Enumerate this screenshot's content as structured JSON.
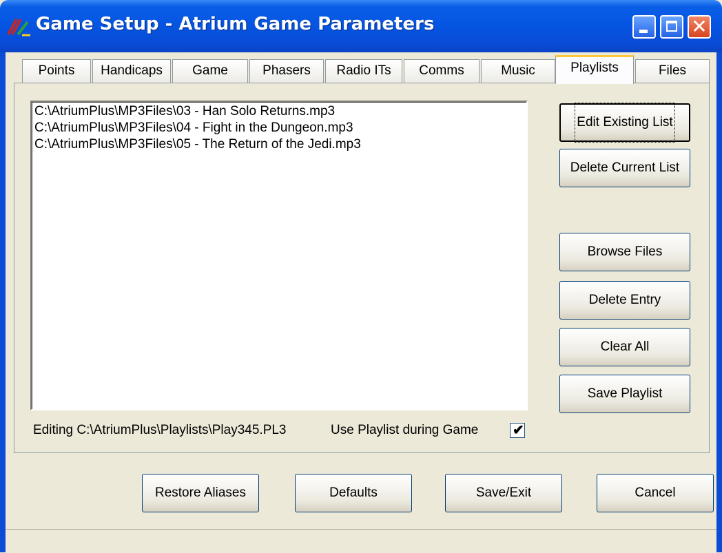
{
  "window": {
    "title": "Game Setup - Atrium Game Parameters",
    "close_glyph": "✕",
    "icons": [
      "app-icon",
      "minimize-icon",
      "maximize-icon",
      "close-icon"
    ]
  },
  "tabs": [
    {
      "label": "Points"
    },
    {
      "label": "Handicaps"
    },
    {
      "label": "Game"
    },
    {
      "label": "Phasers"
    },
    {
      "label": "Radio ITs"
    },
    {
      "label": "Comms"
    },
    {
      "label": "Music"
    },
    {
      "label": "Playlists",
      "active": true
    },
    {
      "label": "Files"
    }
  ],
  "playlist": {
    "entries": [
      "C:\\AtriumPlus\\MP3Files\\03 - Han Solo Returns.mp3",
      "C:\\AtriumPlus\\MP3Files\\04 - Fight in the Dungeon.mp3",
      "C:\\AtriumPlus\\MP3Files\\05 - The Return of the Jedi.mp3"
    ],
    "editing_text": "Editing C:\\AtriumPlus\\Playlists\\Play345.PL3",
    "use_label": "Use Playlist during Game",
    "use_checked": true,
    "check_glyph": "✔"
  },
  "side_buttons": {
    "edit": "Edit Existing List",
    "delete_list": "Delete Current List",
    "browse": "Browse Files",
    "delete_entry": "Delete Entry",
    "clear_all": "Clear All",
    "save_playlist": "Save Playlist"
  },
  "bottom_buttons": {
    "restore": "Restore Aliases",
    "defaults": "Defaults",
    "save_exit": "Save/Exit",
    "cancel": "Cancel"
  },
  "colors": {
    "titlebar": "#0554E2",
    "face": "#ECE9D8",
    "tab_highlight": "#FFC83C",
    "close_button": "#D8451E"
  }
}
